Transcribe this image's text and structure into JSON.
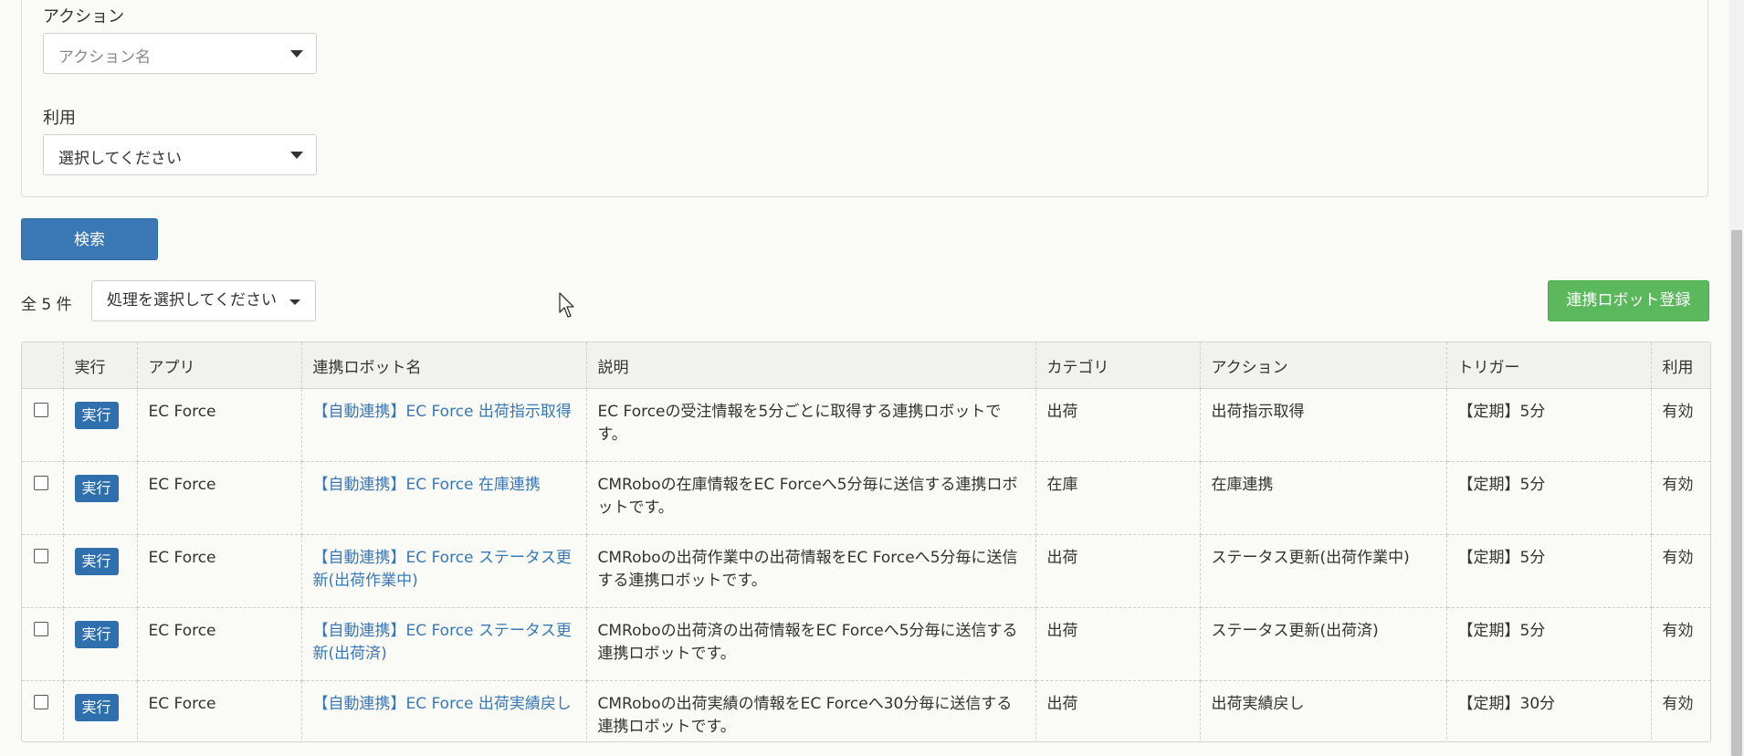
{
  "filters": {
    "action_label": "アクション",
    "action_placeholder": "アクション名",
    "usage_label": "利用",
    "usage_value": "選択してください"
  },
  "search_button": "検索",
  "list": {
    "total_count": "全 5 件",
    "bulk_action": "処理を選択してください",
    "register_button": "連携ロボット登録"
  },
  "table": {
    "headers": [
      "実行",
      "アプリ",
      "連携ロボット名",
      "説明",
      "カテゴリ",
      "アクション",
      "トリガー",
      "利用"
    ],
    "rows": [
      {
        "run": "実行",
        "app": "EC Force",
        "name": "【自動連携】EC Force 出荷指示取得",
        "description": "EC Forceの受注情報を5分ごとに取得する連携ロボットです。",
        "category": "出荷",
        "action": "出荷指示取得",
        "trigger": "【定期】5分",
        "usage": "有効"
      },
      {
        "run": "実行",
        "app": "EC Force",
        "name": "【自動連携】EC Force 在庫連携",
        "description": "CMRoboの在庫情報をEC Forceへ5分毎に送信する連携ロボットです。",
        "category": "在庫",
        "action": "在庫連携",
        "trigger": "【定期】5分",
        "usage": "有効"
      },
      {
        "run": "実行",
        "app": "EC Force",
        "name": "【自動連携】EC Force ステータス更新(出荷作業中)",
        "description": "CMRoboの出荷作業中の出荷情報をEC Forceへ5分毎に送信する連携ロボットです。",
        "category": "出荷",
        "action": "ステータス更新(出荷作業中)",
        "trigger": "【定期】5分",
        "usage": "有効"
      },
      {
        "run": "実行",
        "app": "EC Force",
        "name": "【自動連携】EC Force ステータス更新(出荷済)",
        "description": "CMRoboの出荷済の出荷情報をEC Forceへ5分毎に送信する連携ロボットです。",
        "category": "出荷",
        "action": "ステータス更新(出荷済)",
        "trigger": "【定期】5分",
        "usage": "有効"
      },
      {
        "run": "実行",
        "app": "EC Force",
        "name": "【自動連携】EC Force 出荷実績戻し",
        "description": "CMRoboの出荷実績の情報をEC Forceへ30分毎に送信する連携ロボットです。",
        "category": "出荷",
        "action": "出荷実績戻し",
        "trigger": "【定期】30分",
        "usage": "有効"
      }
    ]
  }
}
